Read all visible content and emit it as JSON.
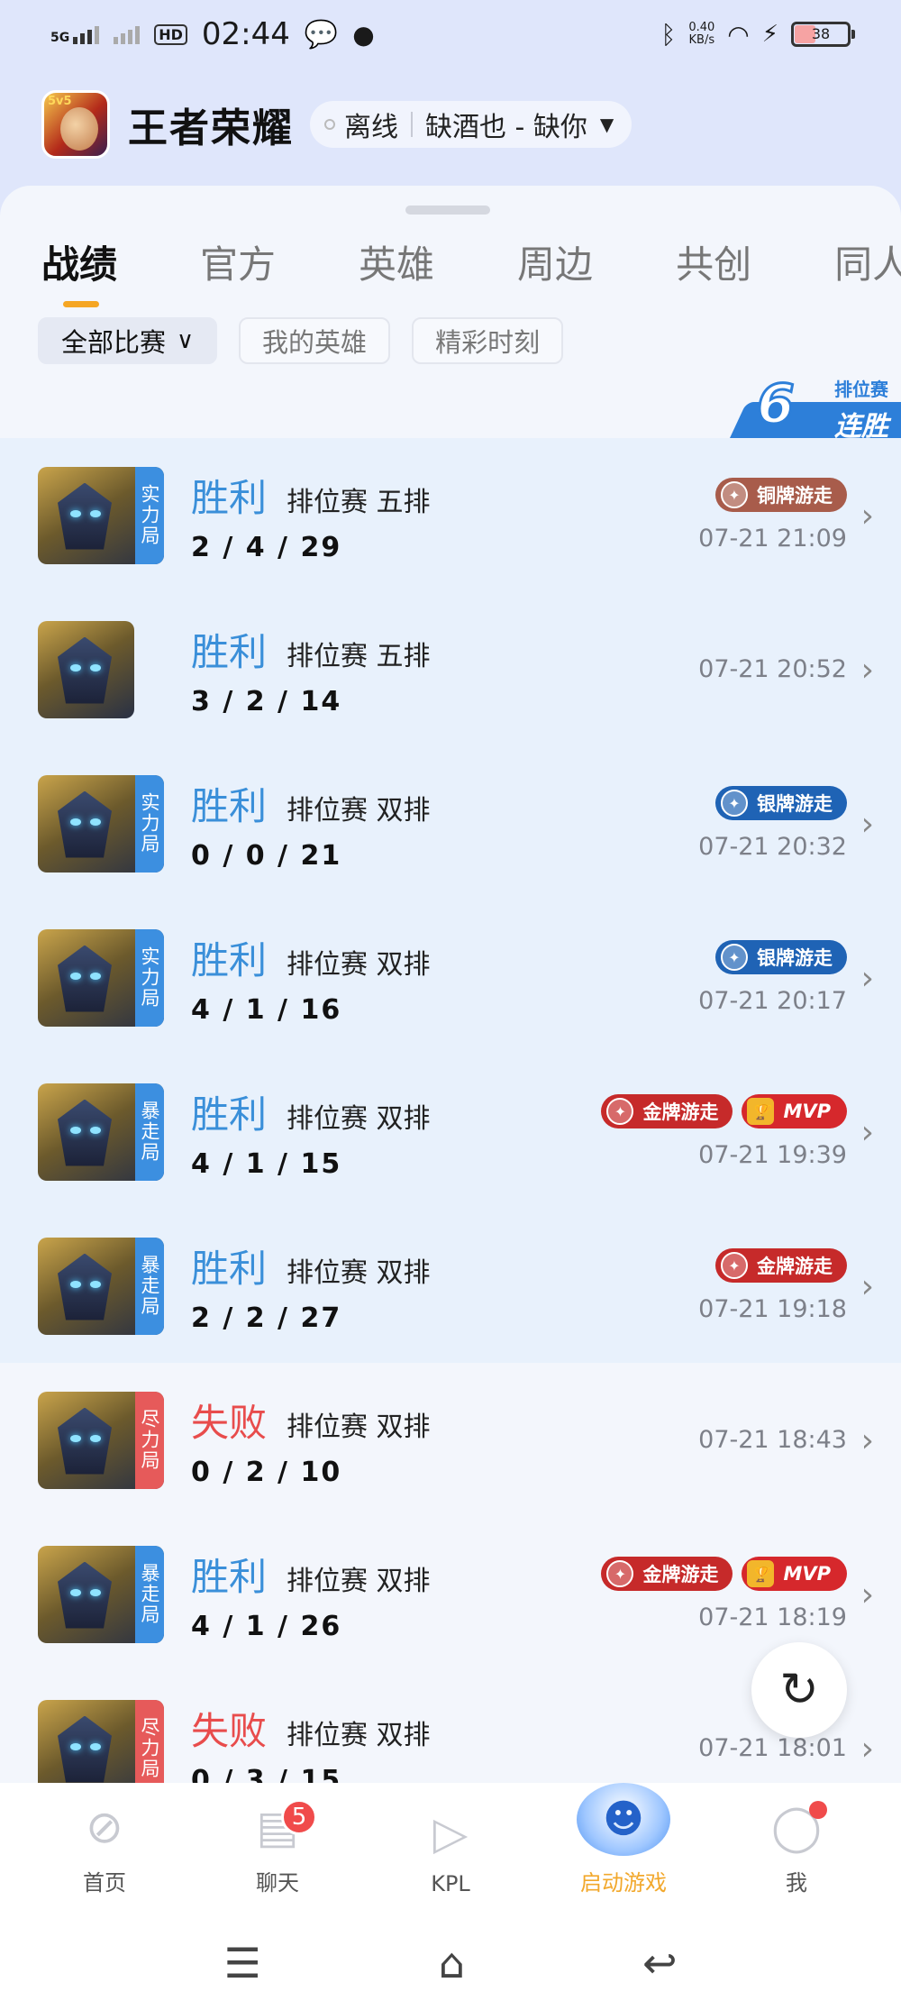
{
  "status_bar": {
    "signal_label": "5G",
    "hd_label": "HD",
    "time": "02:44",
    "net_speed_value": "0.40",
    "net_speed_unit": "KB/s",
    "battery_level": "38"
  },
  "header": {
    "app_title": "王者荣耀",
    "status": "离线",
    "account": "缺酒也 - 缺你"
  },
  "tabs": [
    "战绩",
    "官方",
    "英雄",
    "周边",
    "共创",
    "同人"
  ],
  "filters": [
    {
      "label": "全部比赛",
      "active": true
    },
    {
      "label": "我的英雄",
      "active": false
    },
    {
      "label": "精彩时刻",
      "active": false
    }
  ],
  "streak": {
    "number": "6",
    "line1": "排位赛",
    "line2": "连胜"
  },
  "matches": [
    {
      "result": "胜利",
      "type": "排位赛 五排",
      "kda": "2 / 4 / 29",
      "time": "07-21 21:09",
      "tag": "实力局",
      "badges": [
        "铜牌游走"
      ]
    },
    {
      "result": "胜利",
      "type": "排位赛 五排",
      "kda": "3 / 2 / 14",
      "time": "07-21 20:52",
      "tag": "",
      "badges": []
    },
    {
      "result": "胜利",
      "type": "排位赛 双排",
      "kda": "0 / 0 / 21",
      "time": "07-21 20:32",
      "tag": "实力局",
      "badges": [
        "银牌游走"
      ]
    },
    {
      "result": "胜利",
      "type": "排位赛 双排",
      "kda": "4 / 1 / 16",
      "time": "07-21 20:17",
      "tag": "实力局",
      "badges": [
        "银牌游走"
      ]
    },
    {
      "result": "胜利",
      "type": "排位赛 双排",
      "kda": "4 / 1 / 15",
      "time": "07-21 19:39",
      "tag": "暴走局",
      "badges": [
        "金牌游走",
        "MVP"
      ]
    },
    {
      "result": "胜利",
      "type": "排位赛 双排",
      "kda": "2 / 2 / 27",
      "time": "07-21 19:18",
      "tag": "暴走局",
      "badges": [
        "金牌游走"
      ]
    },
    {
      "result": "失败",
      "type": "排位赛 双排",
      "kda": "0 / 2 / 10",
      "time": "07-21 18:43",
      "tag": "尽力局",
      "badges": []
    },
    {
      "result": "胜利",
      "type": "排位赛 双排",
      "kda": "4 / 1 / 26",
      "time": "07-21 18:19",
      "tag": "暴走局",
      "badges": [
        "金牌游走",
        "MVP"
      ]
    },
    {
      "result": "失败",
      "type": "排位赛 双排",
      "kda": "0 / 3 / 15",
      "time": "07-21 18:01",
      "tag": "尽力局",
      "badges": []
    }
  ],
  "bottom_nav": [
    {
      "label": "首页",
      "icon": "home-icon"
    },
    {
      "label": "聊天",
      "icon": "chat-icon",
      "badge": "5"
    },
    {
      "label": "KPL",
      "icon": "tv-icon"
    },
    {
      "label": "启动游戏",
      "icon": "mascot-icon",
      "active": true
    },
    {
      "label": "我",
      "icon": "profile-icon"
    }
  ],
  "colors": {
    "win": "#3a8fd9",
    "lose": "#e84c4c",
    "accent": "#f5a623"
  }
}
